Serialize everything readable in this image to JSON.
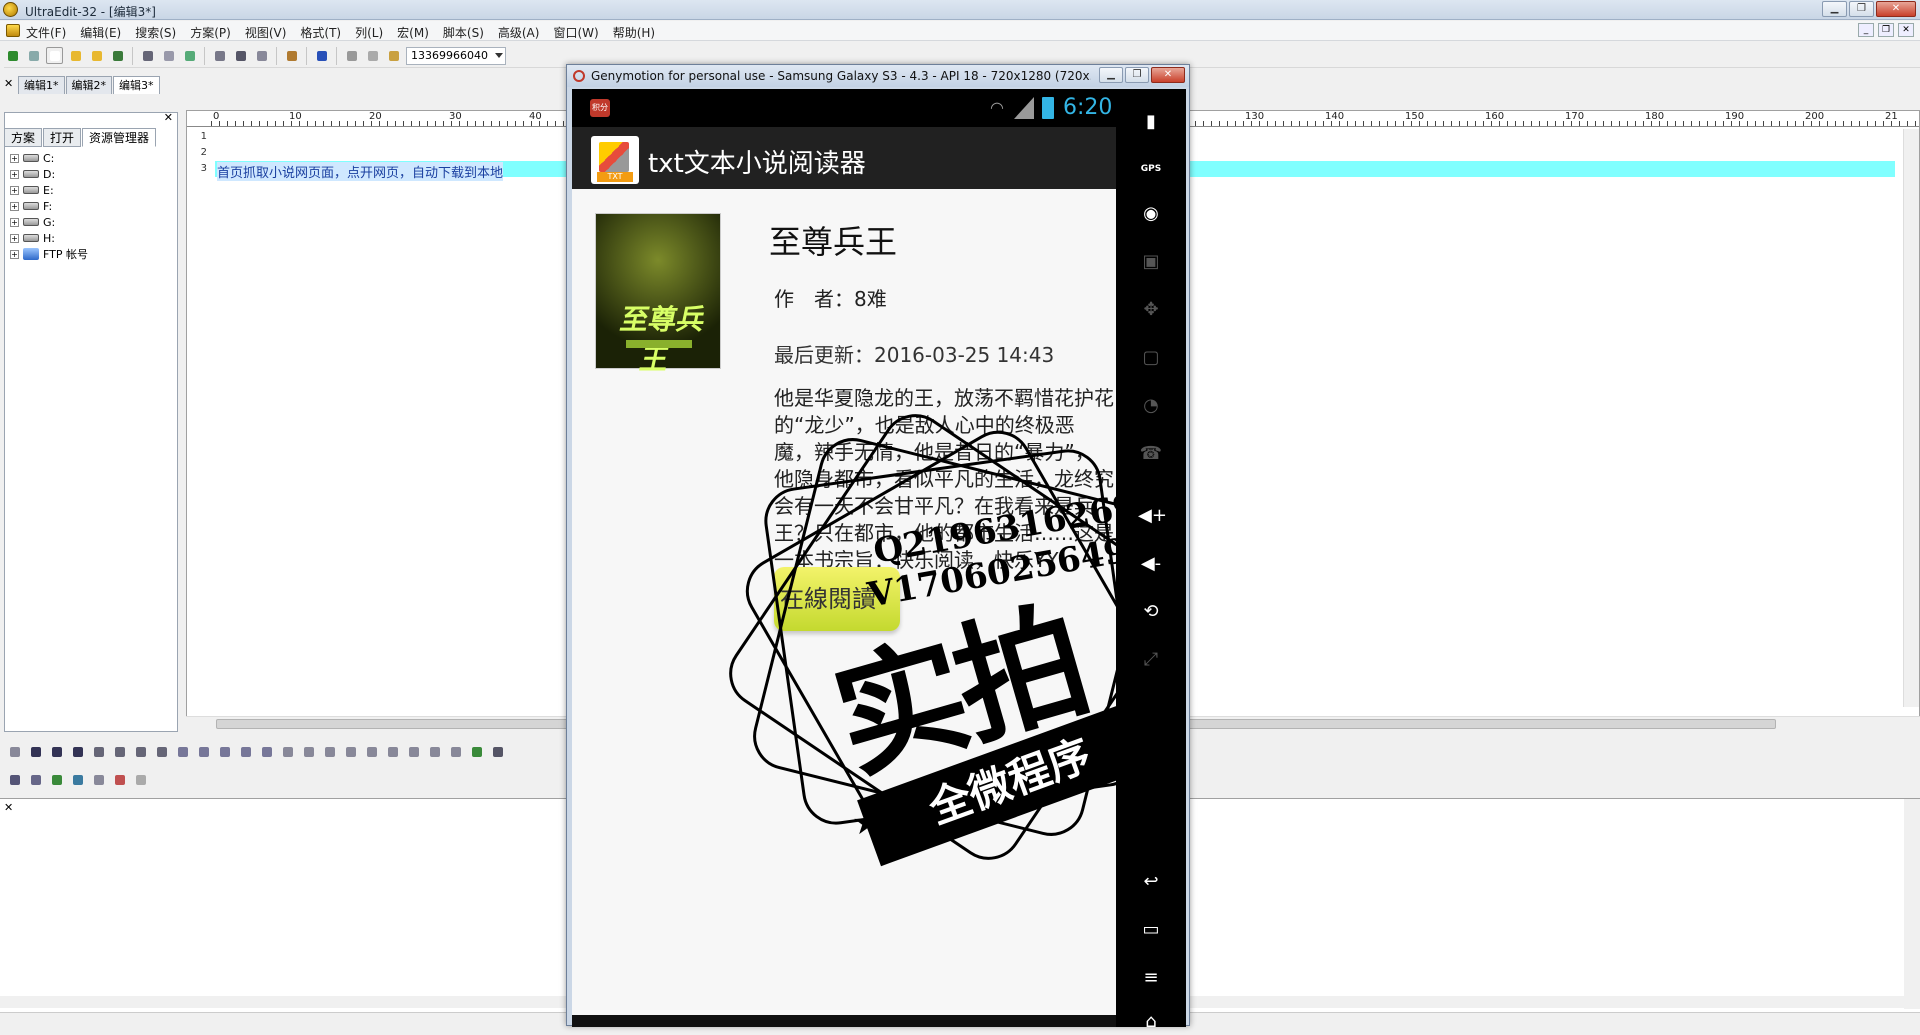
{
  "window": {
    "title": "UltraEdit-32 - [编辑3*]",
    "controls": [
      "minimize-icon",
      "restore-icon",
      "close-icon"
    ]
  },
  "menu": {
    "items": [
      "文件(F)",
      "编辑(E)",
      "搜索(S)",
      "方案(P)",
      "视图(V)",
      "格式(T)",
      "列(L)",
      "宏(M)",
      "脚本(S)",
      "高级(A)",
      "窗口(W)",
      "帮助(H)"
    ]
  },
  "toolbar": {
    "combo_value": "13369966040"
  },
  "doc_tabs": [
    "编辑1*",
    "编辑2*",
    "编辑3*"
  ],
  "explorer": {
    "tabs": [
      "方案",
      "打开",
      "资源管理器"
    ],
    "tree": [
      "C:",
      "D:",
      "E:",
      "F:",
      "G:",
      "H:",
      "FTP 帐号"
    ]
  },
  "editor": {
    "ruler_ticks": [
      "0",
      "10",
      "20",
      "30",
      "40",
      "130",
      "140",
      "150",
      "160",
      "170",
      "180",
      "190",
      "200",
      "21"
    ],
    "line_numbers": [
      "1",
      "2",
      "3"
    ],
    "line3_text": "首页抓取小说网页面，点开网页，自动下载到本地"
  },
  "genymotion": {
    "title": "Genymotion for personal use - Samsung Galaxy S3 - 4.3 - API 18 - 720x1280 (720x..."
  },
  "phone": {
    "notification_badge": "积分",
    "clock": "6:20",
    "app_title": "txt文本小说阅读器",
    "app_icon_label": "TXT",
    "book": {
      "title": "至尊兵王",
      "author": "作　者：8难",
      "updated": "最后更新：2016-03-25 14:43",
      "synopsis": "他是华夏隐龙的王，放荡不羁惜花护花的“龙少”，也是敌人心中的终极恶魔，辣手无情，他是昔日的“暴力”，他隐身都市，看似平凡的生活，龙终究会有一天不会甘平凡？在我看来是兵王？只在都市，他的都市生活……这是一本书宗旨：快乐阅读，快乐YY！",
      "cover_text": "至尊兵王",
      "read_button": "在線閱讀"
    },
    "watermark": {
      "qq1": "Q2196316269",
      "qq2": "V17060256499",
      "big": "实拍",
      "ribbon": "全微程序"
    }
  },
  "emulator_sidebar": [
    "battery-icon",
    "gps-icon",
    "camera-icon",
    "video-icon",
    "dpad-icon",
    "id-icon",
    "rss-icon",
    "phone-icon",
    "volume-up-icon",
    "volume-down-icon",
    "rotate-icon",
    "scale-icon",
    "back-icon",
    "recent-apps-icon",
    "menu-icon",
    "home-icon"
  ]
}
